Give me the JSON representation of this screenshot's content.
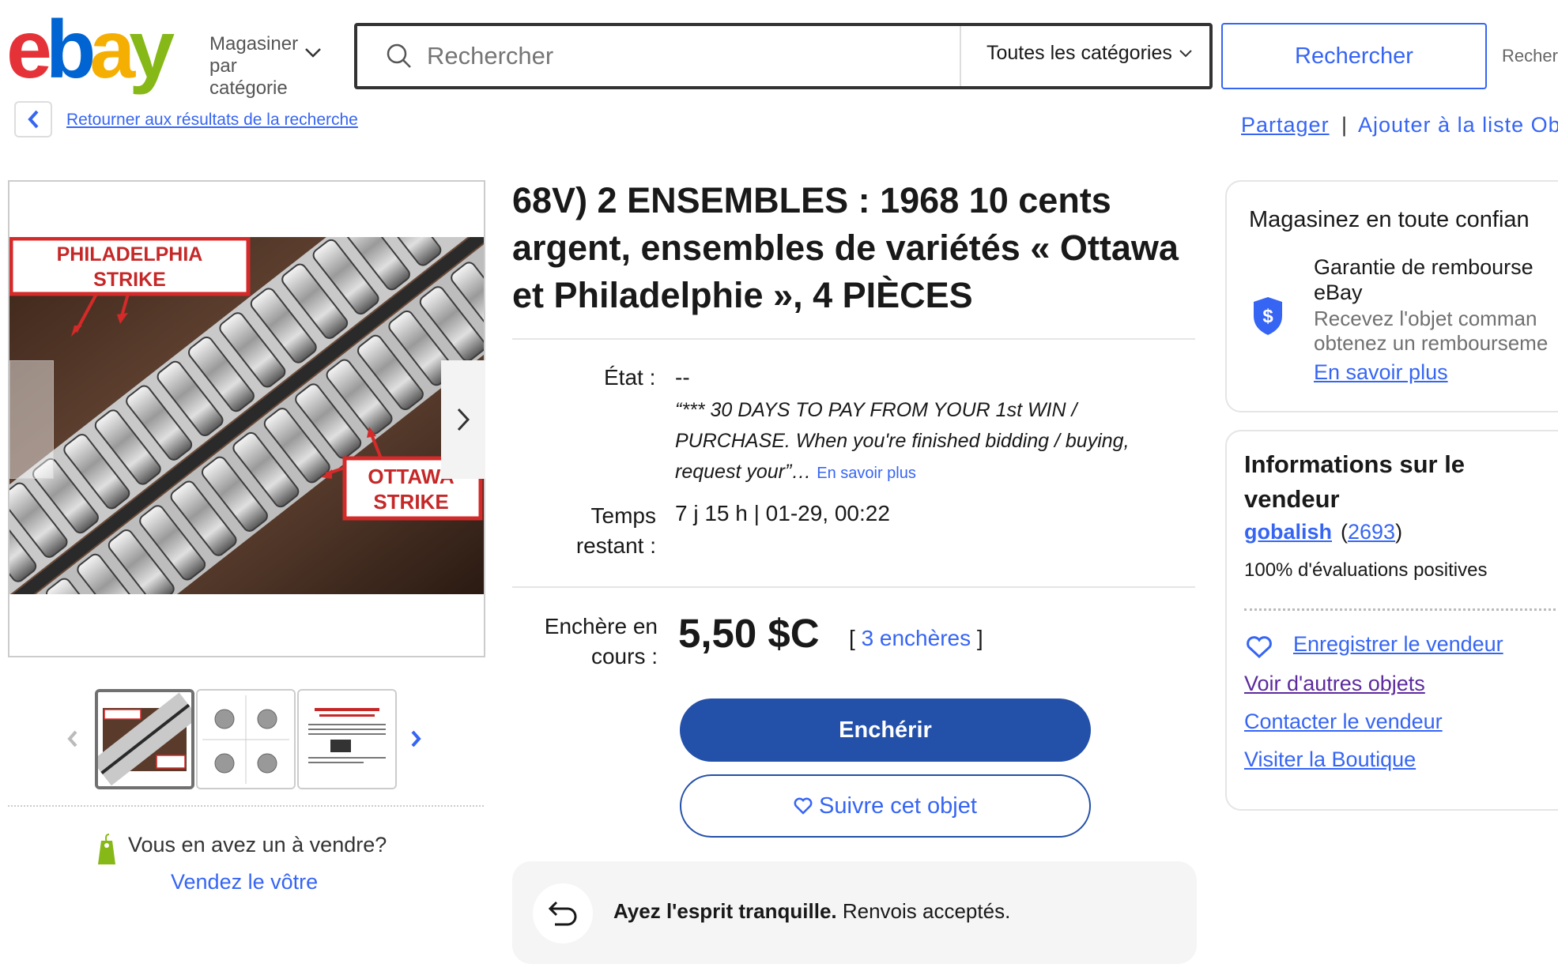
{
  "header": {
    "logo_text": "ebay",
    "shop_by": "Magasiner par catégorie",
    "search_placeholder": "Rechercher",
    "category": "Toutes les catégories",
    "search_button": "Rechercher",
    "advanced": "Recher"
  },
  "nav": {
    "back_link": "Retourner aux résultats de la recherche",
    "share": "Partager",
    "divider": "|",
    "watchlist": "Ajouter à la liste Ob"
  },
  "gallery": {
    "label_top_line1": "PHILADELPHIA",
    "label_top_line2": "STRIKE",
    "label_bottom_line1": "OTTAWA",
    "label_bottom_line2": "STRIKE",
    "thumb_count": 3,
    "sell_question": "Vous en avez un à vendre?",
    "sell_link": "Vendez le vôtre"
  },
  "item": {
    "title": "68V) 2 ENSEMBLES : 1968 10 cents argent, ensembles de variétés « Ottawa et Philadelphie », 4 PIÈCES",
    "condition_label": "État :",
    "condition_value": "--",
    "condition_desc": "“*** 30 DAYS TO PAY FROM YOUR 1st WIN / PURCHASE. When you're finished bidding / buying, request your”… ",
    "condition_more": "En savoir plus",
    "time_label": "Temps restant :",
    "time_value": "7 j 15 h | 01-29, 00:22",
    "bid_label": "Enchère en cours :",
    "price": "5,50 $C",
    "bid_open": "[ ",
    "bids": "3 enchères",
    "bid_close": " ]",
    "bid_button": "Enchérir",
    "watch_button": "Suivre cet objet",
    "returns_bold": "Ayez l'esprit tranquille.",
    "returns_text": " Renvois acceptés."
  },
  "trust": {
    "title": "Magasinez en toute confian",
    "mbg_line1": "Garantie de rembourse",
    "mbg_line2": "eBay",
    "mbg_desc1": "Recevez l'objet comman",
    "mbg_desc2": "obtenez un rembourseme",
    "mbg_link": "En savoir plus"
  },
  "seller": {
    "title": "Informations sur le vendeur",
    "name": "gobalish",
    "score_open": "(",
    "score": "2693",
    "score_close": ")",
    "feedback": "100% d'évaluations positives",
    "save": "Enregistrer le vendeur",
    "other_items": "Voir d'autres objets",
    "contact": "Contacter le vendeur",
    "store": "Visiter la Boutique"
  },
  "colors": {
    "brand_blue": "#3665f3",
    "button_blue": "#2350a8",
    "logo_red": "#e53238",
    "logo_blue": "#0064d2",
    "logo_yellow": "#f5af02",
    "logo_green": "#86b817"
  }
}
